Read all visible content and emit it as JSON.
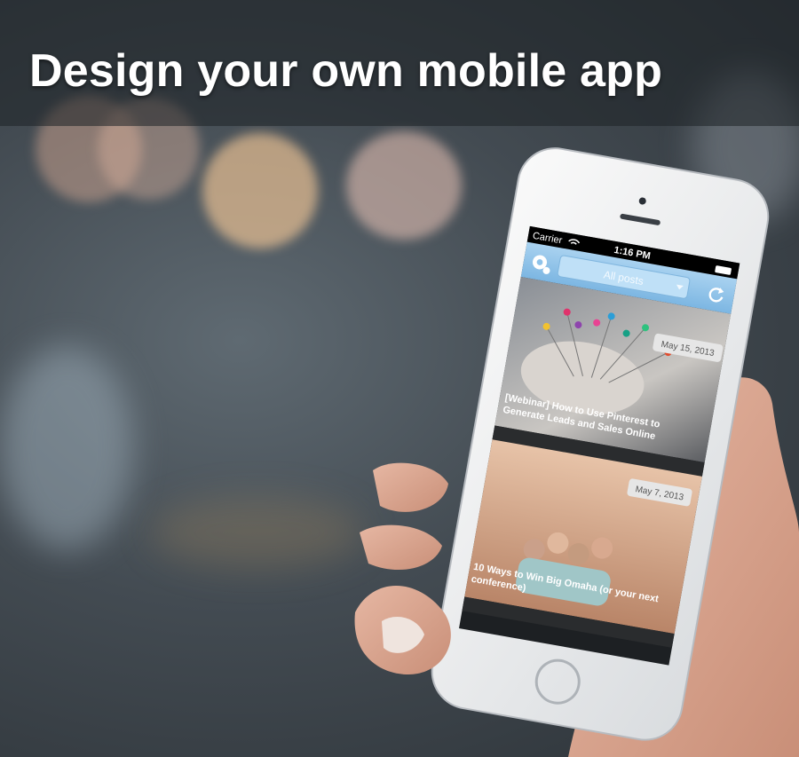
{
  "headline": "Design your own mobile app",
  "phone": {
    "status_bar": {
      "carrier": "Carrier",
      "time": "1:16 PM"
    },
    "nav_bar": {
      "filter_label": "All posts"
    },
    "posts": [
      {
        "date": "May 15, 2013",
        "title_line1": "[Webinar] How to Use Pinterest to",
        "title_line2": "Generate Leads and Sales Online"
      },
      {
        "date": "May 7, 2013",
        "title_line1": "10 Ways to Win Big Omaha (or your next",
        "title_line2": "conference)"
      }
    ]
  },
  "colors": {
    "nav_bar": "#8fc3ea",
    "headline": "#ffffff"
  },
  "icons": [
    "settings-gear-icon",
    "refresh-icon",
    "wifi-icon",
    "battery-icon",
    "dropdown-arrow-icon"
  ]
}
